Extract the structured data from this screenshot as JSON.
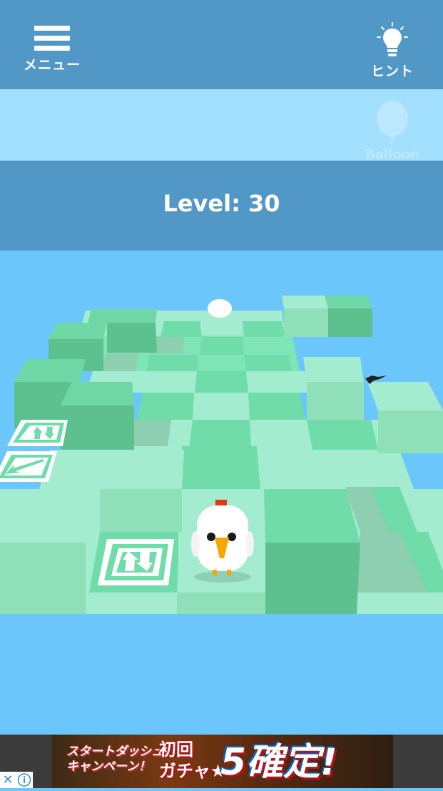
{
  "header": {
    "menu_label": "メニュー",
    "hint_label": "ヒント"
  },
  "balloon": {
    "label": "Balloon"
  },
  "level": {
    "text": "Level: 30"
  },
  "ad": {
    "line1": "スタートダッシュ",
    "line2": "キャンペーン！",
    "gacha_line1": "初回",
    "gacha_line2": "ガチャ★",
    "big": "5確定!",
    "close_glyph": "✕"
  },
  "colors": {
    "header": "#5298c6",
    "sky": "#6ac6fb",
    "tile_light": "#a3ecd0",
    "tile_dark": "#6fdcaa",
    "block_top": "#6fd7a5",
    "block_side": "#5cc18f"
  }
}
